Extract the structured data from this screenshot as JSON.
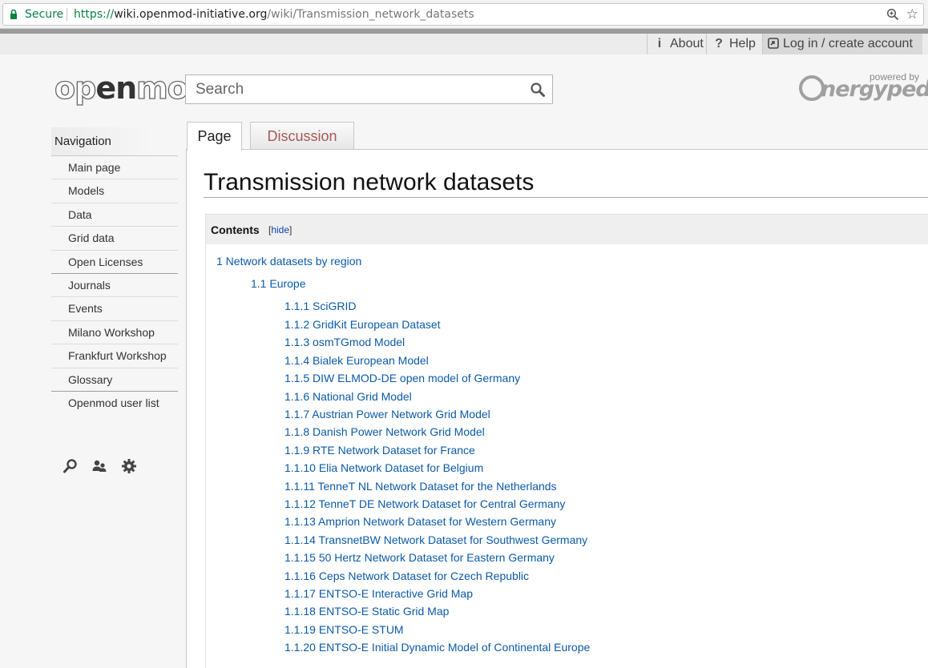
{
  "browser": {
    "secure_label": "Secure",
    "url_proto": "https://",
    "url_host": "wiki.openmod-initiative.org",
    "url_path": "/wiki/Transmission_network_datasets"
  },
  "toplinks": {
    "about": "About",
    "help": "Help",
    "login": "Log in / create account"
  },
  "header": {
    "logo_pre": "op",
    "logo_mid": "en",
    "logo_post": "mod",
    "search_placeholder": "Search",
    "powered_by": "powered by",
    "energypedia": "nergypedia"
  },
  "sidebar": {
    "heading": "Navigation",
    "items": [
      {
        "label": "Main page"
      },
      {
        "label": "Models"
      },
      {
        "label": "Data"
      },
      {
        "label": "Grid data"
      },
      {
        "label": "Open Licenses"
      },
      {
        "label": "Journals"
      },
      {
        "label": "Events"
      },
      {
        "label": "Milano Workshop"
      },
      {
        "label": "Frankfurt Workshop"
      },
      {
        "label": "Glossary"
      },
      {
        "label": "Openmod user list"
      }
    ]
  },
  "tabs": {
    "page": "Page",
    "discussion": "Discussion"
  },
  "page": {
    "title": "Transmission network datasets"
  },
  "toc": {
    "title": "Contents",
    "toggle_open": "[",
    "toggle_label": "hide",
    "toggle_close": "]",
    "items": [
      {
        "text": "1 Network datasets by region",
        "level": 1
      },
      {
        "text": "1.1 Europe",
        "level": 2
      },
      {
        "text": "1.1.1 SciGRID",
        "level": 3
      },
      {
        "text": "1.1.2 GridKit European Dataset",
        "level": 3
      },
      {
        "text": "1.1.3 osmTGmod Model",
        "level": 3
      },
      {
        "text": "1.1.4 Bialek European Model",
        "level": 3
      },
      {
        "text": "1.1.5 DIW ELMOD-DE open model of Germany",
        "level": 3
      },
      {
        "text": "1.1.6 National Grid Model",
        "level": 3
      },
      {
        "text": "1.1.7 Austrian Power Network Grid Model",
        "level": 3
      },
      {
        "text": "1.1.8 Danish Power Network Grid Model",
        "level": 3
      },
      {
        "text": "1.1.9 RTE Network Dataset for France",
        "level": 3
      },
      {
        "text": "1.1.10 Elia Network Dataset for Belgium",
        "level": 3
      },
      {
        "text": "1.1.11 TenneT NL Network Dataset for the Netherlands",
        "level": 3
      },
      {
        "text": "1.1.12 TenneT DE Network Dataset for Central Germany",
        "level": 3
      },
      {
        "text": "1.1.13 Amprion Network Dataset for Western Germany",
        "level": 3
      },
      {
        "text": "1.1.14 TransnetBW Network Dataset for Southwest Germany",
        "level": 3
      },
      {
        "text": "1.1.15 50 Hertz Network Dataset for Eastern Germany",
        "level": 3
      },
      {
        "text": "1.1.16 Ceps Network Dataset for Czech Republic",
        "level": 3
      },
      {
        "text": "1.1.17 ENTSO-E Interactive Grid Map",
        "level": 3
      },
      {
        "text": "1.1.18 ENTSO-E Static Grid Map",
        "level": 3
      },
      {
        "text": "1.1.19 ENTSO-E STUM",
        "level": 3
      },
      {
        "text": "1.1.20 ENTSO-E Initial Dynamic Model of Continental Europe",
        "level": 3
      }
    ]
  },
  "icons": {
    "tools": [
      "search-icon",
      "users-icon",
      "gear-icon"
    ]
  },
  "colors": {
    "link": "#0b5aa8",
    "discussion_tab": "#a55858",
    "secure_green": "#0b8043"
  }
}
